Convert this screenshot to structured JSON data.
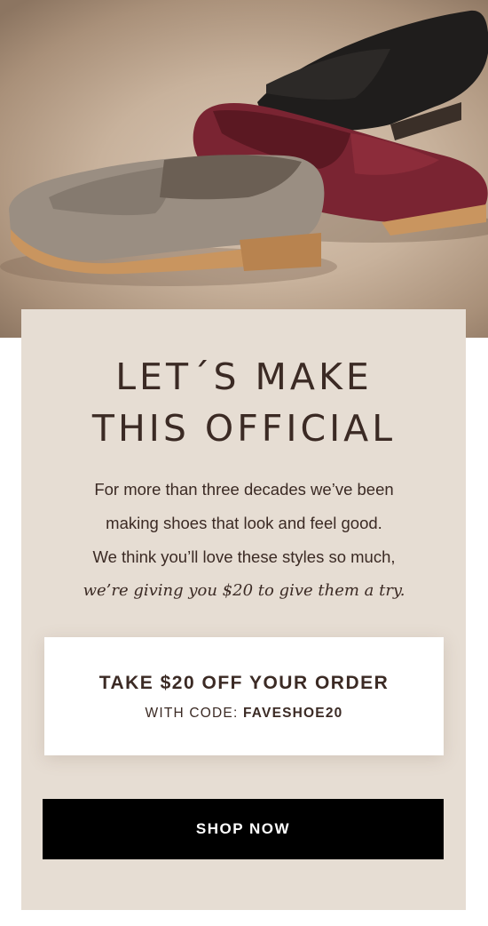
{
  "hero": {
    "image_alt": "three loafers: taupe, burgundy and black",
    "colors": {
      "taupe": "#9a8e82",
      "burgundy": "#7a2432",
      "black": "#1c1a19",
      "sole": "#c9955f"
    }
  },
  "card": {
    "headline_line1": "LET´S MAKE",
    "headline_line2": "THIS OFFICIAL",
    "body_line1": "For more than three decades we’ve been",
    "body_line2": "making shoes that look and feel good.",
    "body_line3": "We think you’ll love these styles so much,",
    "body_line4": "we’re giving you $20 to give them a try.",
    "background": "#e6ddd3",
    "text_color": "#3b2a24"
  },
  "offer": {
    "title": "TAKE $20 OFF YOUR ORDER",
    "code_prefix": "WITH CODE:",
    "code": "FAVESHOE20"
  },
  "cta": {
    "label": "SHOP NOW",
    "background": "#000000"
  }
}
